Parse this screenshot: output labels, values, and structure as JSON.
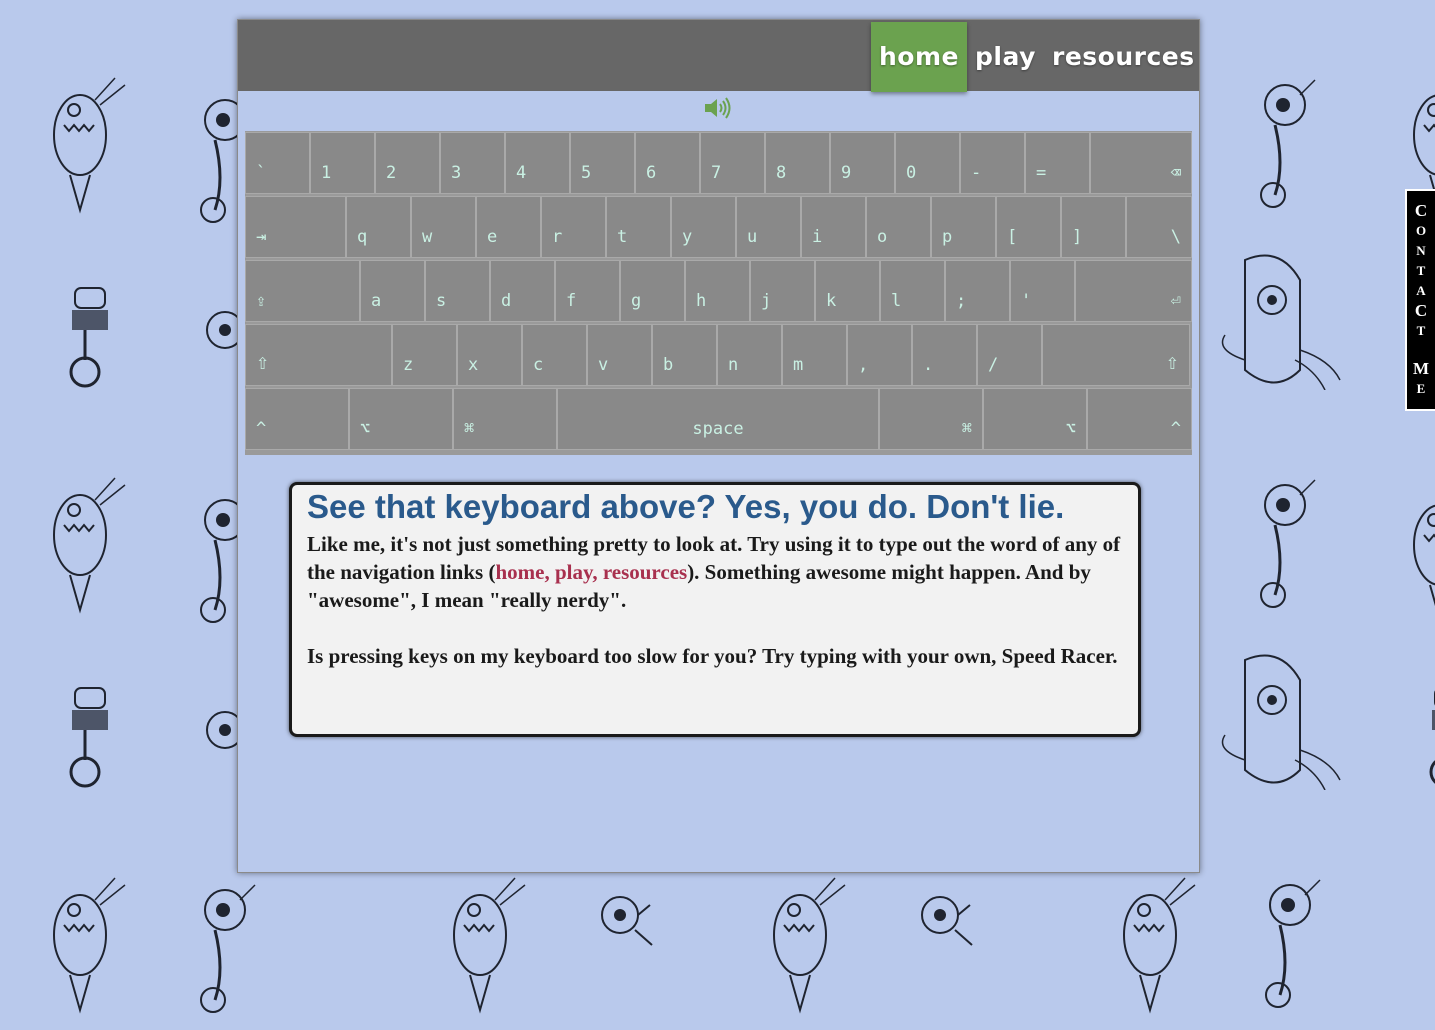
{
  "nav": {
    "home": "home",
    "play": "play",
    "resources": "resources"
  },
  "keyboard": {
    "rows": [
      [
        "`",
        "1",
        "2",
        "3",
        "4",
        "5",
        "6",
        "7",
        "8",
        "9",
        "0",
        "-",
        "=",
        "⌫"
      ],
      [
        "⇥",
        "q",
        "w",
        "e",
        "r",
        "t",
        "y",
        "u",
        "i",
        "o",
        "p",
        "[",
        "]",
        "\\"
      ],
      [
        "⇪",
        "a",
        "s",
        "d",
        "f",
        "g",
        "h",
        "j",
        "k",
        "l",
        ";",
        "'",
        "⏎"
      ],
      [
        "⇧",
        "z",
        "x",
        "c",
        "v",
        "b",
        "n",
        "m",
        ",",
        ".",
        "/",
        "⇧"
      ],
      [
        "^",
        "⌥",
        "⌘",
        "space",
        "⌘",
        "⌥",
        "^"
      ]
    ]
  },
  "info": {
    "heading": "See that keyboard above? Yes, you do. Don't lie.",
    "p1_before": "Like me, it's not just something pretty to look at. Try using it to type out the word of any of the navigation links (",
    "p1_link": "home, play, resources",
    "p1_after": "). Something awesome might happen. And by \"awesome\", I mean \"really nerdy\".",
    "p2": "Is pressing keys on my keyboard too slow for you? Try typing with your own, Speed Racer."
  },
  "contact": {
    "label": "CONTACT ME"
  },
  "colors": {
    "background": "#b9c9ec",
    "navbar": "#676767",
    "nav_active": "#6ba24f",
    "key": "#898989",
    "key_text": "#c9f0e3",
    "heading": "#2a5a8c",
    "link": "#a8304e"
  },
  "icons": {
    "sound": "speaker-volume-icon"
  }
}
